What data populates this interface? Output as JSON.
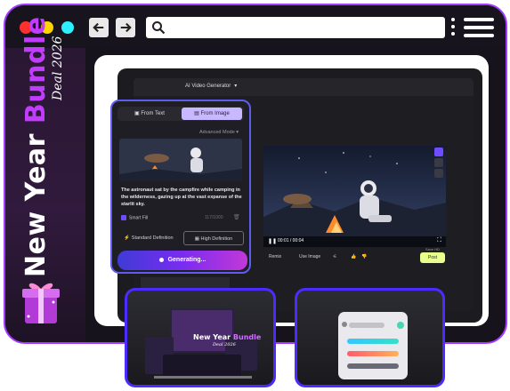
{
  "colors": {
    "traffic_red": "#ff2f2f",
    "traffic_yellow": "#ffd500",
    "traffic_cyan": "#2cf0ff",
    "accent_purple": "#c13cff",
    "accent_blue": "#4a2cff",
    "post_button": "#e8ff8c"
  },
  "browser": {
    "back_icon": "arrow-left-icon",
    "forward_icon": "arrow-right-icon",
    "search_icon": "search-icon",
    "menu_icon": "hamburger-icon"
  },
  "promo": {
    "title_white": "New Year",
    "title_purple": "Bundle",
    "subtitle": "Deal 2026",
    "gift_icon": "gift-icon"
  },
  "app": {
    "title": "AI Video Generator",
    "tabs": [
      {
        "label": "From Text"
      },
      {
        "label": "From Image"
      }
    ],
    "advanced_mode": "Advanced Mode",
    "prompt": "The astronaut sat by the campfire while camping in the wilderness, gazing up at the vast expanse of the starlit sky.",
    "smart_fill": "Smart Fill",
    "char_count": "117/1000",
    "definitions": [
      {
        "label": "Standard Definition"
      },
      {
        "label": "High Definition"
      }
    ],
    "generate_label": "Generating...",
    "video_time": "00:01 / 00:04",
    "actions": {
      "remix": "Remix",
      "use_image": "Use Image",
      "save_label": "Save HD",
      "post": "Post"
    }
  },
  "bottom_card_left": {
    "title_top": "New Year",
    "title_bundle": "Bundle",
    "subtitle": "Deal 2026"
  }
}
